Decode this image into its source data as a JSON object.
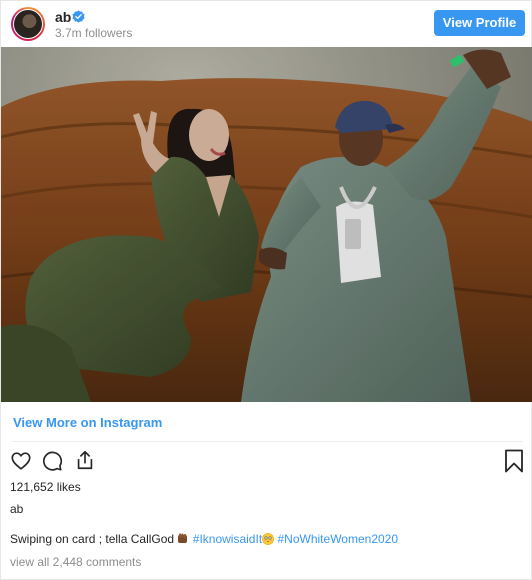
{
  "header": {
    "username": "ab",
    "followers": "3.7m followers",
    "view_profile_label": "View Profile"
  },
  "post": {
    "view_more_label": "View More on Instagram",
    "likes": "121,652 likes",
    "owner": "ab",
    "caption_text": "Swiping on card ; tella CallGod",
    "hashtags": [
      "#IknowisaidIt",
      "#NoWhiteWomen2020"
    ],
    "view_comments": "view all 2,448 comments"
  },
  "colors": {
    "accent": "#3897f0",
    "muted": "#8e8e8e",
    "text": "#262626",
    "border": "#efefef"
  },
  "icons": [
    "verified-badge-icon",
    "heart-icon",
    "comment-icon",
    "share-icon",
    "bookmark-icon",
    "raised-fist-emoji",
    "flushed-face-emoji"
  ]
}
